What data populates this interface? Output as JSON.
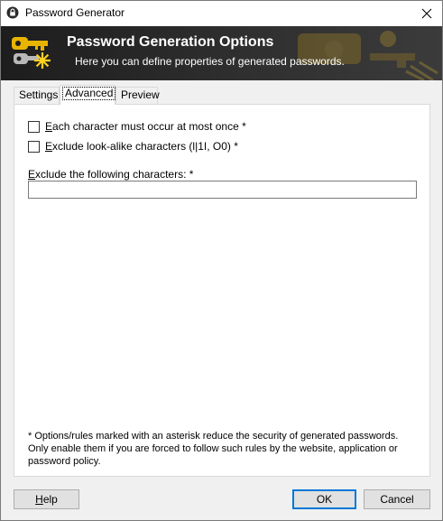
{
  "window": {
    "title": "Password Generator",
    "close_icon": "close-icon"
  },
  "banner": {
    "title": "Password Generation Options",
    "subtitle": "Here you can define properties of generated passwords.",
    "icon": "keys-icon"
  },
  "tabs": [
    {
      "label": "Settings",
      "active": false
    },
    {
      "label": "Advanced",
      "active": true
    },
    {
      "label": "Preview",
      "active": false
    }
  ],
  "options": {
    "each_char_once": {
      "accel": "E",
      "rest": "ach character must occur at most once *",
      "checked": false
    },
    "exclude_lookalike": {
      "accel": "E",
      "rest": "xclude look-alike characters (l|1I, O0) *",
      "checked": false
    },
    "exclude_label_accel": "E",
    "exclude_label_rest": "xclude the following characters: *",
    "exclude_value": ""
  },
  "note": "* Options/rules marked with an asterisk reduce the security of generated passwords. Only enable them if you are forced to follow such rules by the website, application or password policy.",
  "buttons": {
    "help_accel": "H",
    "help_rest": "elp",
    "ok": "OK",
    "cancel": "Cancel"
  },
  "colors": {
    "banner_bg": "#1d1d1d",
    "banner_text": "#ffffff",
    "default_button_border": "#0078d7"
  }
}
